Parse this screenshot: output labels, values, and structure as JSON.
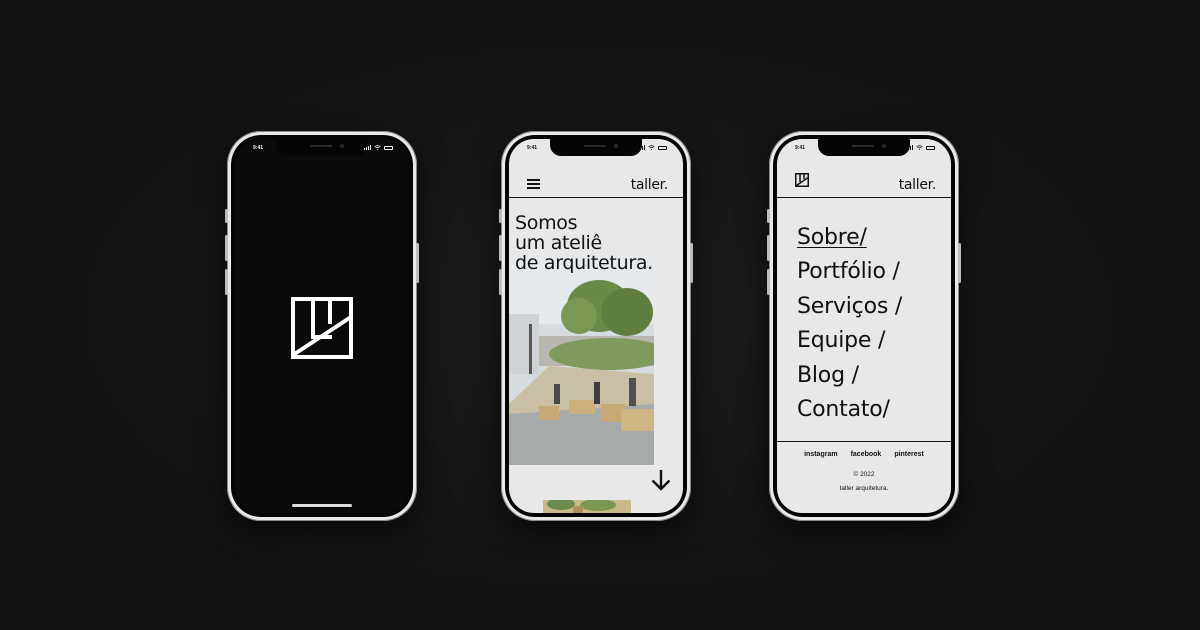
{
  "colors": {
    "background": "#131313",
    "phone_frame": "#e9e9e9",
    "screen_dark": "#0a0a0a",
    "screen_light": "#e8e8e8",
    "ink": "#111111"
  },
  "status_bar": {
    "time": "9:41"
  },
  "icons": {
    "brand_mark": "square-logo-icon",
    "menu": "hamburger-icon",
    "scroll": "arrow-down-icon",
    "signal": "signal-icon",
    "wifi": "wifi-icon",
    "battery": "battery-icon"
  },
  "header": {
    "brand": "taller."
  },
  "hero": {
    "lines": [
      "Somos",
      "um ateliê",
      "de arquitetura."
    ]
  },
  "menu": {
    "items": [
      "Sobre/",
      "Portfólio /",
      "Serviços /",
      "Equipe /",
      "Blog /",
      "Contato/"
    ]
  },
  "footer": {
    "social": [
      "instagram",
      "facebook",
      "pinterest"
    ],
    "copyright": "© 2022",
    "company": "taller arquitetura."
  }
}
